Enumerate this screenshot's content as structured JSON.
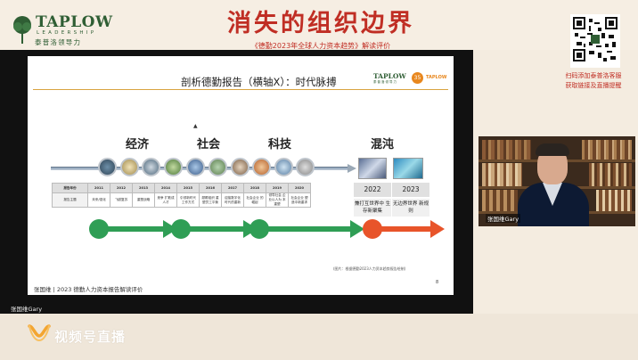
{
  "banner": {
    "logo_name": "TAPLOW",
    "logo_sub": "LEADERSHIP",
    "logo_zh": "泰普洛领导力",
    "title": "消失的组织边界",
    "subtitle": "《德勤2023年全球人力资本趋势》解读评价",
    "qr_text_line1": "扫码添加泰普洛客服",
    "qr_text_line2": "获取链接及直播提醒"
  },
  "slide": {
    "heading": "剖析德勤报告（横轴X）：时代脉搏",
    "logo_name": "TAPLOW",
    "logo_sub": "泰普洛领导力",
    "badge": "35",
    "categories": [
      "经济",
      "社会",
      "科技",
      "混沌"
    ],
    "table": {
      "row_label_year": "报告年份",
      "row_label_topic": "报告主题",
      "years": [
        "2011",
        "2012",
        "2013",
        "2014",
        "2015",
        "2016",
        "2017",
        "2018",
        "2019",
        "2020"
      ],
      "topics": [
        "未来/强化",
        "飞越复苏",
        "重塑战略",
        "竞争 扩散成人才",
        "引领新时代 工作方式",
        "颠覆组织 重塑员工平衡",
        "迎接数字化 时代的重新",
        "社会企业 的崛起",
        "领导社会 企业以人为 本重塑",
        "社会企业 塑造中新重求"
      ]
    },
    "chaos_years": [
      {
        "year": "2022",
        "text": "兼打互世界中 生存新聚集"
      },
      {
        "year": "2023",
        "text": "无边界世界 新规则"
      }
    ],
    "footnote": "(图片：根据德勤2023人力资本趋势报告绘制)",
    "page_number": "8",
    "footer": "张国维 | 2023 德勤人力资本报告解读评价"
  },
  "video": {
    "presenter_label": "张国维Gary",
    "speaker_label": "张国维Gary"
  },
  "live": {
    "label": "视频号直播"
  },
  "colors": {
    "brand_green": "#2f5e34",
    "title_red": "#c02e24",
    "arrow_green": "#2f9e55",
    "arrow_orange": "#e8542a"
  }
}
